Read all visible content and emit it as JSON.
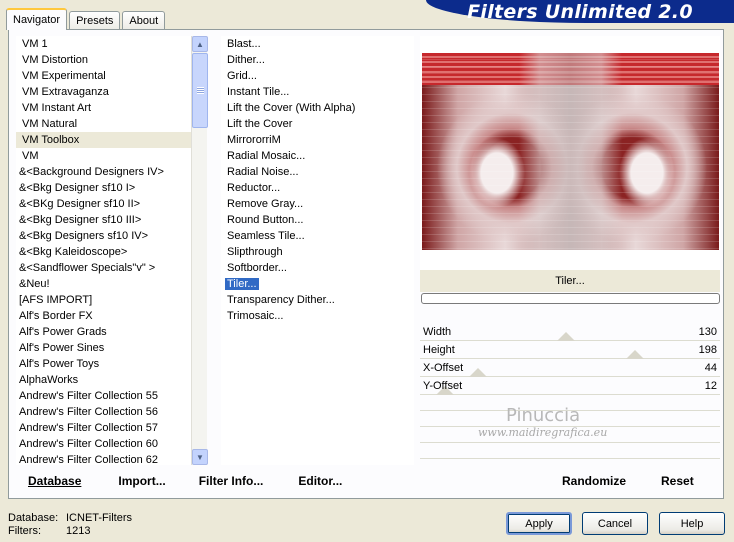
{
  "tabs": [
    "Navigator",
    "Presets",
    "About"
  ],
  "title": "Filters Unlimited 2.0",
  "categories": [
    "VM 1",
    "VM Distortion",
    "VM Experimental",
    "VM Extravaganza",
    "VM Instant Art",
    "VM Natural",
    "VM Toolbox",
    "VM",
    "&<Background Designers IV>",
    "&<Bkg Designer sf10 I>",
    "&<BKg Designer sf10 II>",
    "&<Bkg Designer sf10 III>",
    "&<Bkg Designers sf10 IV>",
    "&<Bkg Kaleidoscope>",
    "&<Sandflower Specials\"v\" >",
    "&Neu!",
    "[AFS IMPORT]",
    "Alf's Border FX",
    "Alf's Power Grads",
    "Alf's Power Sines",
    "Alf's Power Toys",
    "AlphaWorks",
    "Andrew's Filter Collection 55",
    "Andrew's Filter Collection 56",
    "Andrew's Filter Collection 57",
    "Andrew's Filter Collection 60",
    "Andrew's Filter Collection 62"
  ],
  "selected_category": "VM Toolbox",
  "filters": [
    "Blast...",
    "Dither...",
    "Grid...",
    "Instant Tile...",
    "Lift the Cover (With Alpha)",
    "Lift the Cover",
    "MirrororriM",
    "Radial Mosaic...",
    "Radial Noise...",
    "Reductor...",
    "Remove Gray...",
    "Round Button...",
    "Seamless Tile...",
    "Slipthrough",
    "Softborder...",
    "Tiler...",
    "Transparency Dither...",
    "Trimosaic..."
  ],
  "selected_filter": "Tiler...",
  "filter_name": "Tiler...",
  "params": [
    {
      "label": "Width",
      "value": "130"
    },
    {
      "label": "Height",
      "value": "198"
    },
    {
      "label": "X-Offset",
      "value": "44"
    },
    {
      "label": "Y-Offset",
      "value": "12"
    }
  ],
  "param_levels": [
    130,
    198,
    44,
    12
  ],
  "watermark": {
    "name": "Pinuccia",
    "url": "www.maidiregrafica.eu"
  },
  "left_buttons": [
    "Database",
    "Import...",
    "Filter Info...",
    "Editor..."
  ],
  "right_buttons": [
    "Randomize",
    "Reset"
  ],
  "status": {
    "database_label": "Database:",
    "database_value": "ICNET-Filters",
    "filters_label": "Filters:",
    "filters_value": "1213"
  },
  "dialog_buttons": {
    "apply": "Apply",
    "cancel": "Cancel",
    "help": "Help"
  }
}
